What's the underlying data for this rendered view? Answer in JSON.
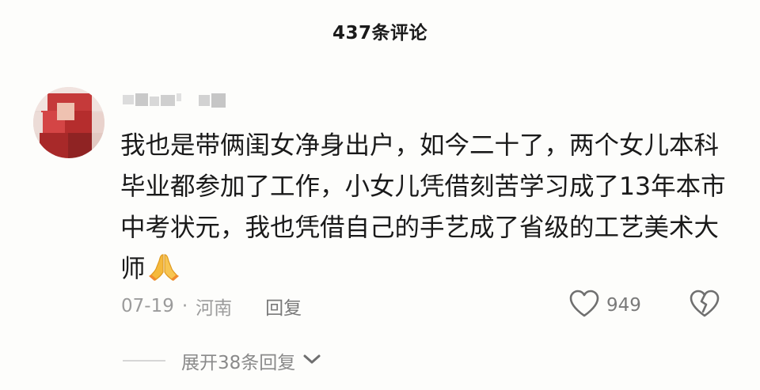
{
  "header": {
    "title": "437条评论"
  },
  "comment": {
    "author_icon": "avatar-blurred",
    "text": "我也是带俩闺女净身出户，如今二十了，两个女儿本科毕业都参加了工作，小女儿凭借刻苦学习成了13年本市中考状元，我也凭借自己的手艺成了省级的工艺美术大师",
    "emoji": "folded-hands",
    "date": "07-19",
    "separator": "·",
    "location": "河南",
    "reply_label": "回复",
    "like_count": "949",
    "like_icon": "heart-outline-icon",
    "dislike_icon": "broken-heart-icon"
  },
  "replies": {
    "expand_label": "展开38条回复",
    "expand_icon": "chevron-down-icon"
  },
  "colors": {
    "background": "#fdfdfb",
    "text": "#1a1a1a",
    "meta": "#9b9b9b",
    "emoji": "#f5b93b"
  }
}
